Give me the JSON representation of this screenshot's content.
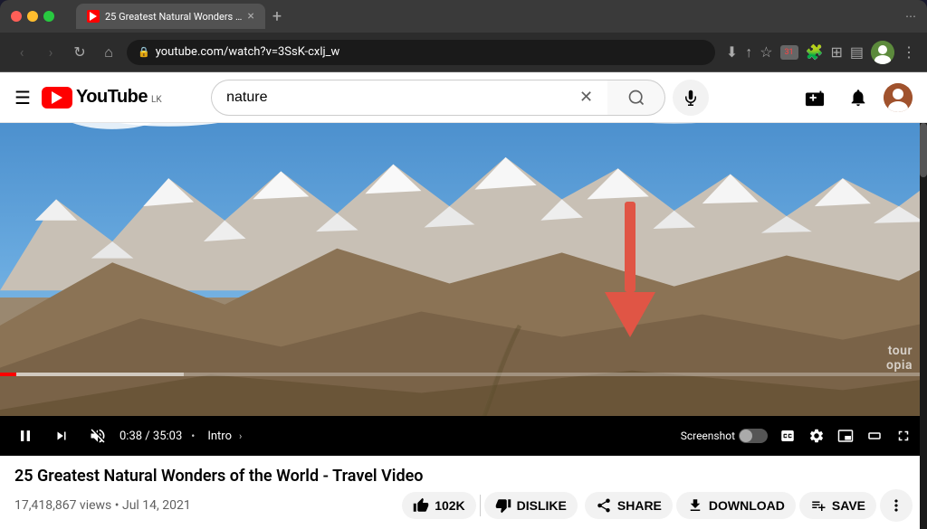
{
  "browser": {
    "tab_title": "25 Greatest Natural Wonders …",
    "url": "youtube.com/watch?v=3SsK-cxlj_w",
    "new_tab_label": "+",
    "close_tab_label": "×",
    "nav": {
      "back": "‹",
      "forward": "›",
      "reload": "↻",
      "home": "⌂"
    }
  },
  "youtube": {
    "logo_text": "YouTube",
    "logo_country": "LK",
    "search_value": "nature",
    "search_placeholder": "Search",
    "watermark_line1": "tour",
    "watermark_line2": "opia",
    "video": {
      "title": "25 Greatest Natural Wonders of the World - Travel Video",
      "views": "17,418,867 views",
      "date": "Jul 14, 2021",
      "likes": "102K",
      "time_current": "0:38",
      "time_total": "35:03",
      "chapter": "Intro",
      "screenshot_label": "Screenshot"
    },
    "controls": {
      "play_label": "⏸",
      "next_label": "⏭",
      "mute_label": "🔇",
      "cc_label": "CC",
      "settings_label": "⚙",
      "miniplayer_label": "⬛",
      "theater_label": "▬",
      "fullscreen_label": "⛶"
    },
    "actions": {
      "like_label": "👍 102K",
      "dislike_label": "👎 DISLIKE",
      "share_label": "↗ SHARE",
      "download_label": "⬇ DOWNLOAD",
      "save_label": "＋ SAVE",
      "more_label": "•••"
    },
    "header_icons": {
      "create": "➕",
      "notifications": "🔔",
      "menu": "☰"
    }
  }
}
